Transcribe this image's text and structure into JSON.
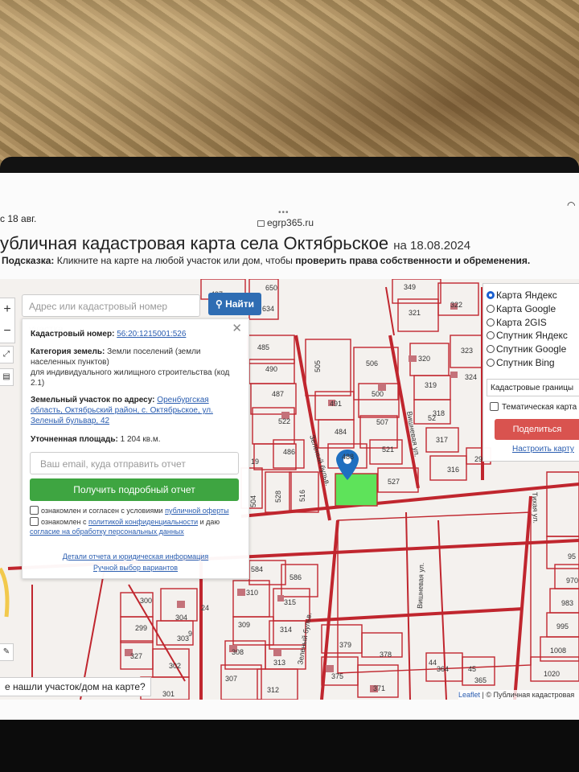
{
  "status": {
    "time": "с 18 авг.",
    "url": "egrp365.ru"
  },
  "page": {
    "title": "убличная кадастровая карта села Октябрьское",
    "title_date": "на 18.08.2024",
    "hint_label": "Подсказка:",
    "hint_text": "Кликните на карте на любой участок или дом, чтобы",
    "hint_bold": "проверить права собственности и обременения."
  },
  "search": {
    "placeholder": "Адрес или кадастровый номер участка",
    "button": "Найти"
  },
  "parcel": {
    "cadastral_label": "Кадастровый номер:",
    "cadastral_number": "56:20:1215001:526",
    "category_label": "Категория земель:",
    "category_value": "Земли поселений (земли населенных пунктов)",
    "usage": "для индивидуального жилищного строительства (код 2.1)",
    "address_label": "Земельный участок по адресу:",
    "address_value": "Оренбургская область, Октябрьский район, с. Октябрьское, ул. Зеленый бульвар, 42",
    "area_label": "Уточненная площадь:",
    "area_value": "1 204 кв.м.",
    "email_placeholder": "Ваш email, куда отправить отчет",
    "report_button": "Получить подробный отчет",
    "consent1_prefix": "ознакомлен и согласен с условиями",
    "consent1_link": "публичной оферты",
    "consent2_prefix": "ознакомлен с",
    "consent2_link": "политикой конфиденциальности",
    "consent2_mid": "и даю",
    "consent2_link2": "согласие на обработку персональных данных",
    "details_link": "Детали отчета и юридическая информация",
    "manual_link": "Ручной выбор вариантов"
  },
  "layers": {
    "options": [
      "Карта Яндекс",
      "Карта Google",
      "Карта 2GIS",
      "Спутник Яндекс",
      "Спутник Google",
      "Спутник Bing"
    ],
    "selected": "Карта Яндекс",
    "boundary_select": "Кадастровые границы",
    "thematic": "Тематическая карта",
    "share": "Поделиться ссылкой",
    "setup": "Настроить карту"
  },
  "not_found": "е нашли участок/дом на карте?",
  "attribution": {
    "leaflet": "Leaflet",
    "text": "| © Публичная кадастровая"
  },
  "streets": {
    "green": "Зеленый бульв.",
    "vishnevaya": "Вишневая ул.",
    "vishnevaya2": "Вишневая ул.",
    "green2": "Зеленый бульв.",
    "tikhaya": "Тихая ул."
  },
  "plots": [
    "497",
    "650",
    "349",
    "321",
    "322",
    "634",
    "485",
    "490",
    "505",
    "506",
    "320",
    "323",
    "319",
    "318",
    "324",
    "491",
    "500",
    "487",
    "484",
    "507",
    "52",
    "317",
    "522",
    "486",
    "488",
    "521",
    "316",
    "29",
    "516",
    "528",
    "504",
    "527",
    "95",
    "970",
    "983",
    "995",
    "1008",
    "1020",
    "584",
    "586",
    "310",
    "315",
    "300",
    "304",
    "309",
    "314",
    "299",
    "303",
    "308",
    "313",
    "379",
    "378",
    "327",
    "302",
    "307",
    "312",
    "375",
    "371",
    "364",
    "365",
    "301",
    "44",
    "45",
    "9",
    "24",
    "39"
  ],
  "colors": {
    "boundary": "#c0262e",
    "selected": "#5ee35a",
    "accent": "#2f6db3",
    "green_btn": "#3ea541",
    "share_btn": "#d9534f"
  }
}
